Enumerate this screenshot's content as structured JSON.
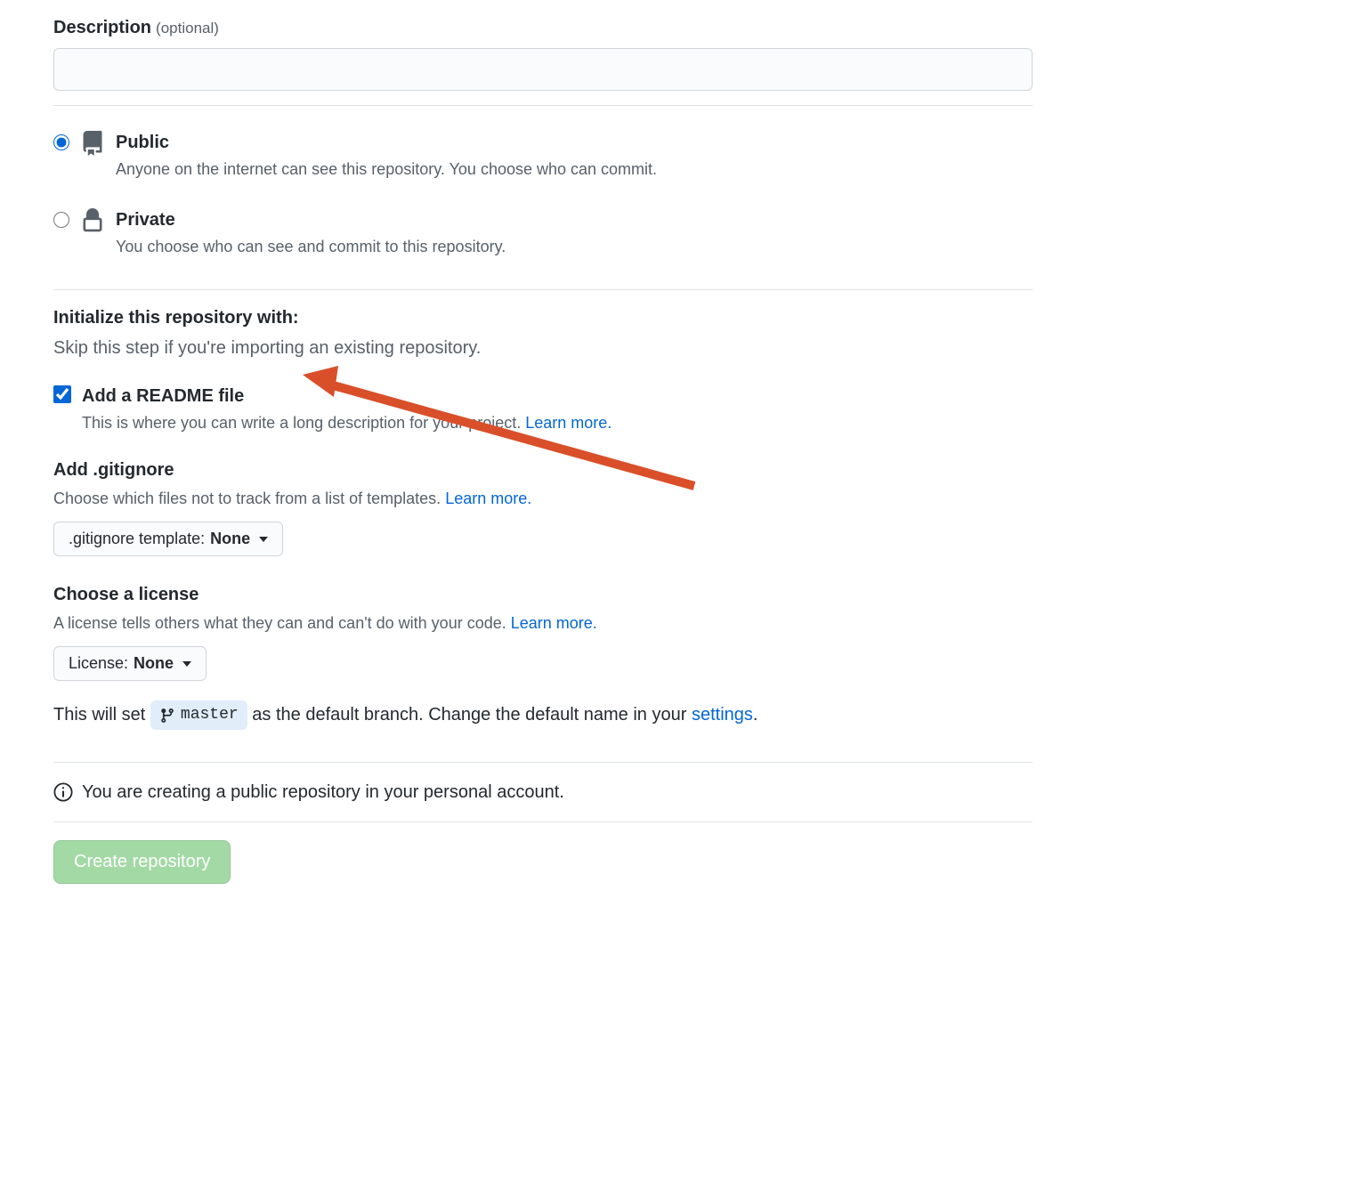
{
  "description": {
    "label": "Description",
    "optional": "(optional)",
    "value": ""
  },
  "visibility": {
    "public": {
      "title": "Public",
      "desc": "Anyone on the internet can see this repository. You choose who can commit.",
      "selected": true
    },
    "private": {
      "title": "Private",
      "desc": "You choose who can see and commit to this repository.",
      "selected": false
    }
  },
  "initialize": {
    "heading": "Initialize this repository with:",
    "sub": "Skip this step if you're importing an existing repository.",
    "readme": {
      "title": "Add a README file",
      "desc_prefix": "This is where you can write a long description for your project. ",
      "learn_more": "Learn more.",
      "checked": true
    },
    "gitignore": {
      "heading": "Add .gitignore",
      "desc_prefix": "Choose which files not to track from a list of templates. ",
      "learn_more": "Learn more.",
      "btn_prefix": ".gitignore template: ",
      "btn_value": "None"
    },
    "license": {
      "heading": "Choose a license",
      "desc_prefix": "A license tells others what they can and can't do with your code. ",
      "learn_more": "Learn more.",
      "btn_prefix": "License: ",
      "btn_value": "None"
    }
  },
  "branch_note": {
    "prefix": "This will set ",
    "branch": "master",
    "mid": " as the default branch. Change the default name in your ",
    "link": "settings",
    "suffix": "."
  },
  "info": "You are creating a public repository in your personal account.",
  "submit": "Create repository"
}
